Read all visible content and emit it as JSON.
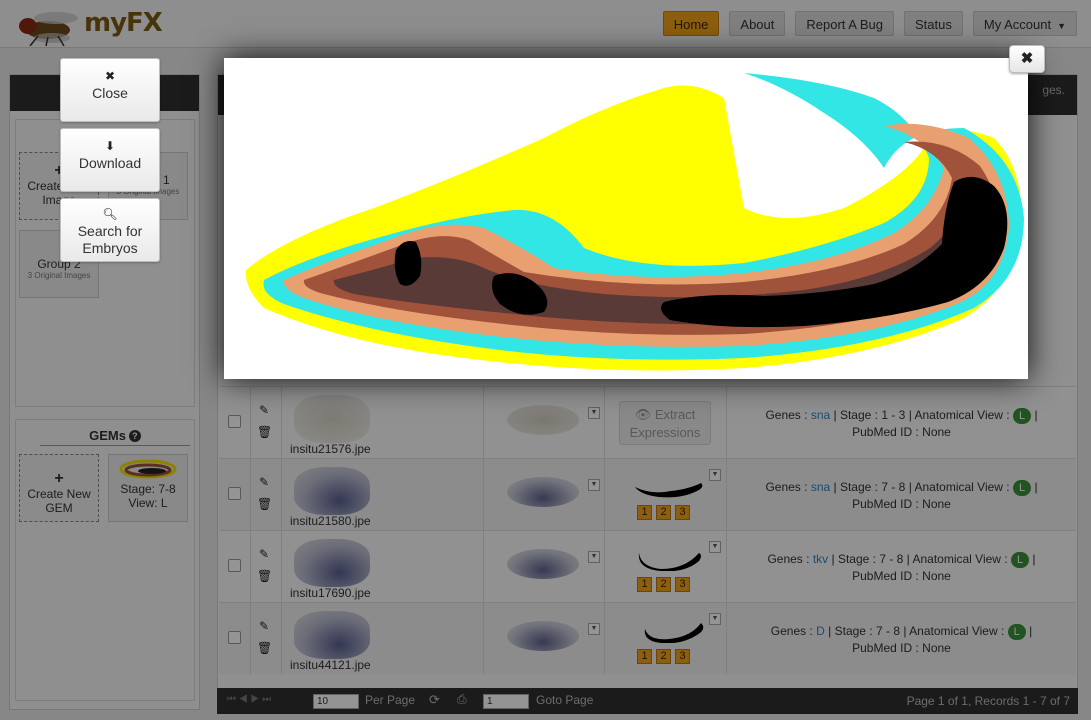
{
  "app": {
    "logo_text": "myFX"
  },
  "nav": {
    "items": [
      {
        "label": "Home",
        "active": true
      },
      {
        "label": "About",
        "active": false
      },
      {
        "label": "Report A Bug",
        "active": false
      },
      {
        "label": "Status",
        "active": false
      },
      {
        "label": "My Account",
        "active": false
      }
    ]
  },
  "sidebar": {
    "groups": {
      "create_label": "Create New Image",
      "group1_label": "Group 1",
      "group1_sub": "3 Original Images",
      "group2_label": "Group 2",
      "group2_sub": "3 Original Images"
    },
    "gems": {
      "title": "GEMs",
      "create_label": "Create New GEM",
      "gem1_label": "Stage: 7-8 View: L"
    }
  },
  "modal": {
    "buttons": {
      "close": "Close",
      "download": "Download",
      "search": "Search for Embryos"
    },
    "close_x": "✖",
    "colors": {
      "yellow": "#ffff00",
      "cyan": "#33e6e6",
      "peach": "#e8a070",
      "brown": "#a0523a",
      "dark": "#5a3a36",
      "black": "#000000"
    }
  },
  "table": {
    "extract_label": "Extract Expressions",
    "rows": [
      {
        "file": "insitu21576.jpe",
        "gene": "sna",
        "stage": "1 - 3",
        "view": "L",
        "pubmed": "None",
        "has_gem": false
      },
      {
        "file": "insitu21580.jpe",
        "gene": "sna",
        "stage": "7 - 8",
        "view": "L",
        "pubmed": "None",
        "has_gem": true
      },
      {
        "file": "insitu17690.jpe",
        "gene": "tkv",
        "stage": "7 - 8",
        "view": "L",
        "pubmed": "None",
        "has_gem": true
      },
      {
        "file": "insitu44121.jpe",
        "gene": "D",
        "stage": "7 - 8",
        "view": "L",
        "pubmed": "None",
        "has_gem": true
      }
    ],
    "labels": {
      "genes": "Genes :",
      "stage": "Stage :",
      "view": "Anatomical View :",
      "pubmed": "PubMed ID :"
    },
    "badge_labels": [
      "1",
      "2",
      "3"
    ],
    "truncated_text": "ges.",
    "pager": {
      "per_page_value": "10",
      "per_page_label": "Per Page",
      "goto_value": "1",
      "goto_label": "Goto Page",
      "status": "Page 1 of 1, Records 1 - 7 of 7"
    }
  }
}
